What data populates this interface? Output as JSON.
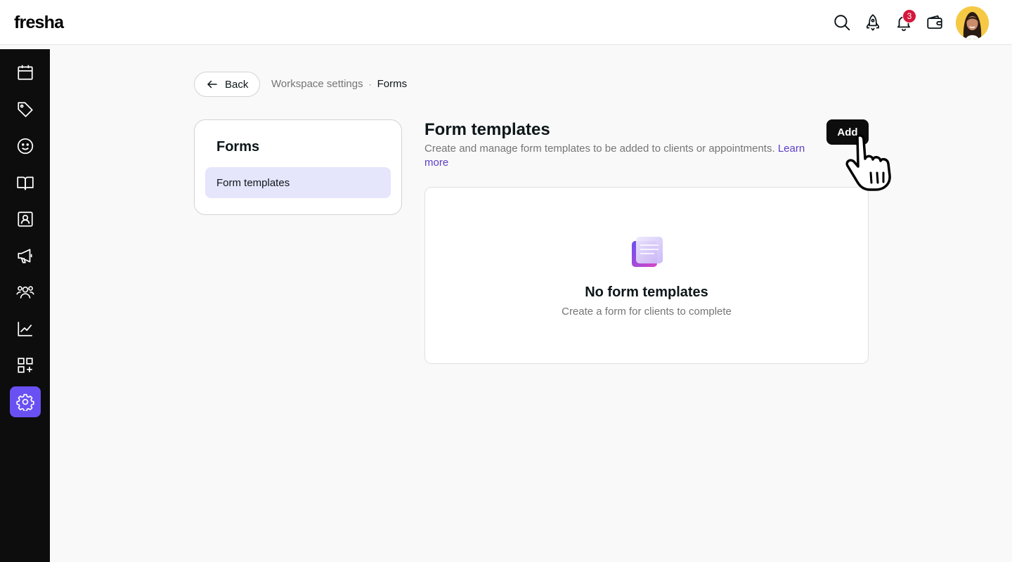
{
  "header": {
    "logo": "fresha",
    "notification_count": "3"
  },
  "sidebar": {
    "items": [
      {
        "icon": "calendar-icon"
      },
      {
        "icon": "tag-icon"
      },
      {
        "icon": "smiley-icon"
      },
      {
        "icon": "book-icon"
      },
      {
        "icon": "contact-card-icon"
      },
      {
        "icon": "megaphone-icon"
      },
      {
        "icon": "team-icon"
      },
      {
        "icon": "chart-icon"
      },
      {
        "icon": "add-apps-icon"
      },
      {
        "icon": "settings-icon",
        "active": true
      }
    ]
  },
  "breadcrumb": {
    "back_label": "Back",
    "parent": "Workspace settings",
    "separator": "·",
    "current": "Forms"
  },
  "side_nav": {
    "title": "Forms",
    "items": [
      {
        "label": "Form templates",
        "selected": true
      }
    ]
  },
  "main": {
    "title": "Form templates",
    "description": "Create and manage form templates to be added to clients or appointments.",
    "learn_more": "Learn more",
    "add_label": "Add",
    "empty_title": "No form templates",
    "empty_subtitle": "Create a form for clients to complete"
  },
  "colors": {
    "accent": "#6950f3",
    "selected_bg": "#e5e5fc",
    "link": "#5c3ec7",
    "badge": "#d4183d"
  }
}
